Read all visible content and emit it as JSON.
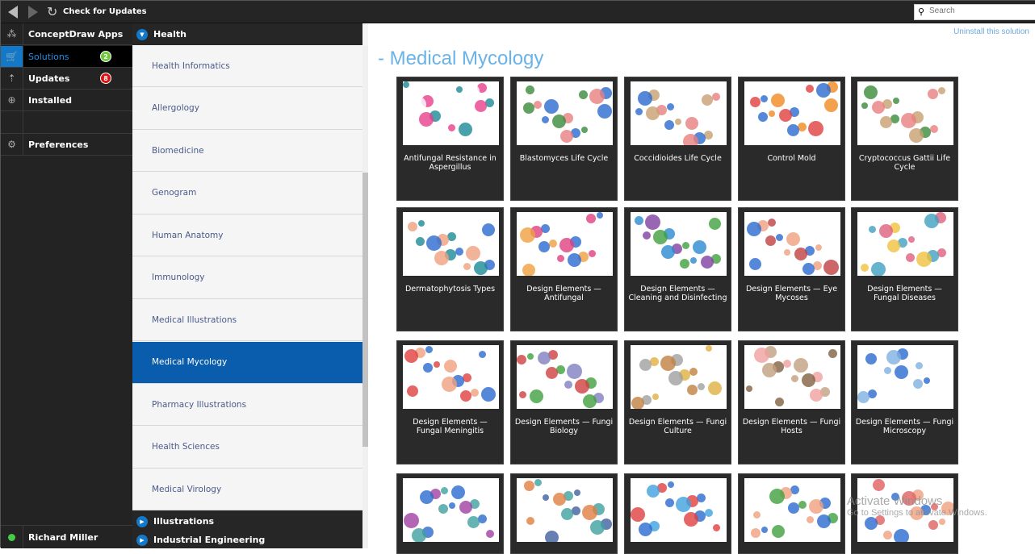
{
  "toolbar": {
    "check_updates": "Check for Updates",
    "search_placeholder": "Search"
  },
  "left_nav": {
    "items": [
      {
        "label": "ConceptDraw Apps",
        "icon": "apps-icon"
      },
      {
        "label": "Solutions",
        "icon": "cart-icon",
        "badge": "2",
        "active": true
      },
      {
        "label": "Updates",
        "icon": "updates-icon",
        "badge": "8"
      },
      {
        "label": "Installed",
        "icon": "download-icon"
      },
      {
        "label": "Preferences",
        "icon": "gear-icon"
      }
    ],
    "user": "Richard Miller"
  },
  "categories": {
    "health": "Health",
    "illustrations": "Illustrations",
    "industrial": "Industrial Engineering",
    "solutions": [
      "Health Informatics",
      "Allergology",
      "Biomedicine",
      "Genogram",
      "Human Anatomy",
      "Immunology",
      "Medical Illustrations",
      "Medical Mycology",
      "Pharmacy Illustrations",
      "Health Sciences",
      "Medical Virology"
    ],
    "selected": "Medical Mycology"
  },
  "main": {
    "uninstall": "Uninstall this solution",
    "title": "- Medical Mycology",
    "cards": [
      "Antifungal Resistance in Aspergillus",
      "Blastomyces Life Cycle",
      "Coccidioides Life Cycle",
      "Control Mold",
      "Cryptococcus Gattii Life Cycle",
      "Dermatophytosis Types",
      "Design Elements — Antifungal",
      "Design Elements — Cleaning and Disinfecting",
      "Design Elements — Eye Mycoses",
      "Design Elements — Fungal Diseases",
      "Design Elements — Fungal Meningitis",
      "Design Elements — Fungi Biology",
      "Design Elements — Fungi Culture",
      "Design Elements — Fungi Hosts",
      "Design Elements — Fungi Microscopy",
      "",
      "",
      "",
      "",
      ""
    ]
  },
  "watermark": {
    "line1": "Activate Windows",
    "line2": "Go to Settings to activate Windows."
  }
}
